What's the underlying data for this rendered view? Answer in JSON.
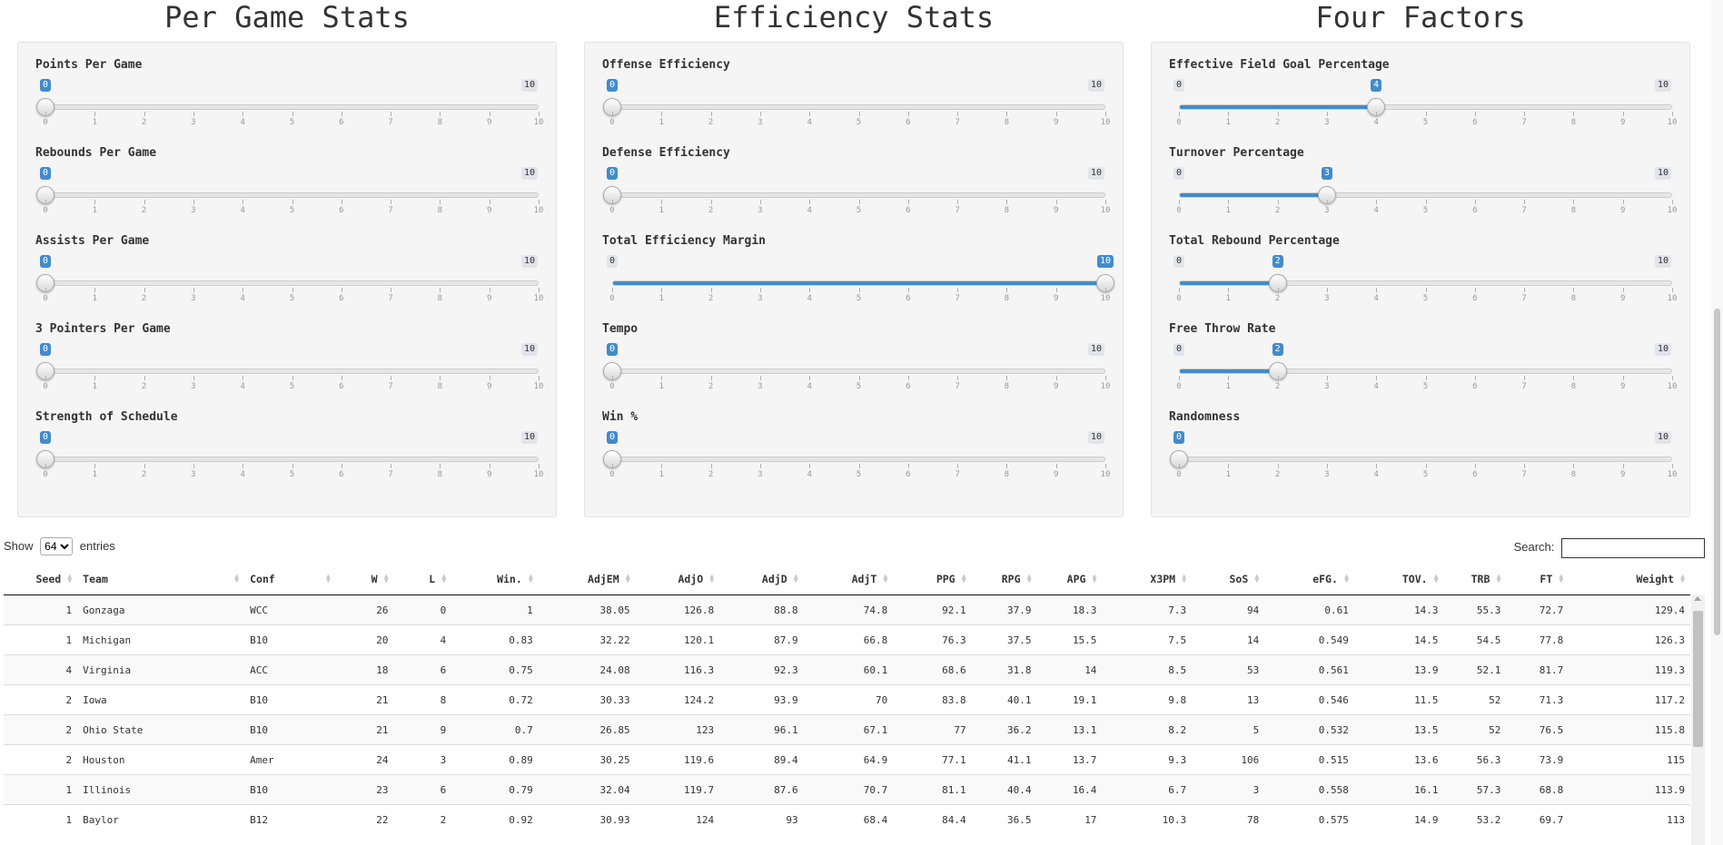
{
  "columns": [
    {
      "title": "Per Game Stats",
      "sliders": [
        {
          "label": "Points Per Game",
          "value": 0,
          "min": 0,
          "max": 10,
          "range": false
        },
        {
          "label": "Rebounds Per Game",
          "value": 0,
          "min": 0,
          "max": 10,
          "range": false
        },
        {
          "label": "Assists Per Game",
          "value": 0,
          "min": 0,
          "max": 10,
          "range": false
        },
        {
          "label": "3 Pointers Per Game",
          "value": 0,
          "min": 0,
          "max": 10,
          "range": false
        },
        {
          "label": "Strength of Schedule",
          "value": 0,
          "min": 0,
          "max": 10,
          "range": false
        }
      ]
    },
    {
      "title": "Efficiency Stats",
      "sliders": [
        {
          "label": "Offense Efficiency",
          "value": 0,
          "min": 0,
          "max": 10,
          "range": false
        },
        {
          "label": "Defense Efficiency",
          "value": 0,
          "min": 0,
          "max": 10,
          "range": false
        },
        {
          "label": "Total Efficiency Margin",
          "value": 10,
          "min": 0,
          "max": 10,
          "range": true
        },
        {
          "label": "Tempo",
          "value": 0,
          "min": 0,
          "max": 10,
          "range": false
        },
        {
          "label": "Win %",
          "value": 0,
          "min": 0,
          "max": 10,
          "range": false
        }
      ]
    },
    {
      "title": "Four Factors",
      "sliders": [
        {
          "label": "Effective Field Goal Percentage",
          "value": 4,
          "min": 0,
          "max": 10,
          "range": true
        },
        {
          "label": "Turnover Percentage",
          "value": 3,
          "min": 0,
          "max": 10,
          "range": true
        },
        {
          "label": "Total Rebound Percentage",
          "value": 2,
          "min": 0,
          "max": 10,
          "range": true
        },
        {
          "label": "Free Throw Rate",
          "value": 2,
          "min": 0,
          "max": 10,
          "range": true
        },
        {
          "label": "Randomness",
          "value": 0,
          "min": 0,
          "max": 10,
          "range": false
        }
      ]
    }
  ],
  "table_controls": {
    "show_label": "Show",
    "entries_value": "64",
    "entries_label": "entries",
    "search_label": "Search:"
  },
  "table": {
    "headers": [
      "Seed",
      "Team",
      "Conf",
      "W",
      "L",
      "Win.",
      "AdjEM",
      "AdjO",
      "AdjD",
      "AdjT",
      "PPG",
      "RPG",
      "APG",
      "X3PM",
      "SoS",
      "eFG.",
      "TOV.",
      "TRB",
      "FT",
      "Weight"
    ],
    "rows": [
      [
        "1",
        "Gonzaga",
        "WCC",
        "26",
        "0",
        "1",
        "38.05",
        "126.8",
        "88.8",
        "74.8",
        "92.1",
        "37.9",
        "18.3",
        "7.3",
        "94",
        "0.61",
        "14.3",
        "55.3",
        "72.7",
        "129.4"
      ],
      [
        "1",
        "Michigan",
        "B10",
        "20",
        "4",
        "0.83",
        "32.22",
        "120.1",
        "87.9",
        "66.8",
        "76.3",
        "37.5",
        "15.5",
        "7.5",
        "14",
        "0.549",
        "14.5",
        "54.5",
        "77.8",
        "126.3"
      ],
      [
        "4",
        "Virginia",
        "ACC",
        "18",
        "6",
        "0.75",
        "24.08",
        "116.3",
        "92.3",
        "60.1",
        "68.6",
        "31.8",
        "14",
        "8.5",
        "53",
        "0.561",
        "13.9",
        "52.1",
        "81.7",
        "119.3"
      ],
      [
        "2",
        "Iowa",
        "B10",
        "21",
        "8",
        "0.72",
        "30.33",
        "124.2",
        "93.9",
        "70",
        "83.8",
        "40.1",
        "19.1",
        "9.8",
        "13",
        "0.546",
        "11.5",
        "52",
        "71.3",
        "117.2"
      ],
      [
        "2",
        "Ohio State",
        "B10",
        "21",
        "9",
        "0.7",
        "26.85",
        "123",
        "96.1",
        "67.1",
        "77",
        "36.2",
        "13.1",
        "8.2",
        "5",
        "0.532",
        "13.5",
        "52",
        "76.5",
        "115.8"
      ],
      [
        "2",
        "Houston",
        "Amer",
        "24",
        "3",
        "0.89",
        "30.25",
        "119.6",
        "89.4",
        "64.9",
        "77.1",
        "41.1",
        "13.7",
        "9.3",
        "106",
        "0.515",
        "13.6",
        "56.3",
        "73.9",
        "115"
      ],
      [
        "1",
        "Illinois",
        "B10",
        "23",
        "6",
        "0.79",
        "32.04",
        "119.7",
        "87.6",
        "70.7",
        "81.1",
        "40.4",
        "16.4",
        "6.7",
        "3",
        "0.558",
        "16.1",
        "57.3",
        "68.8",
        "113.9"
      ],
      [
        "1",
        "Baylor",
        "B12",
        "22",
        "2",
        "0.92",
        "30.93",
        "124",
        "93",
        "68.4",
        "84.4",
        "36.5",
        "17",
        "10.3",
        "78",
        "0.575",
        "14.9",
        "53.2",
        "69.7",
        "113"
      ]
    ]
  }
}
